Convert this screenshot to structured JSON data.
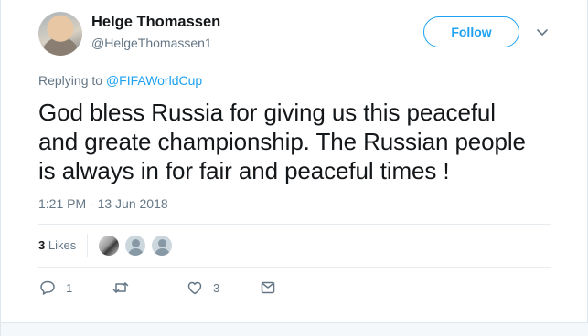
{
  "author": {
    "name": "Helge Thomassen",
    "handle": "@HelgeThomassen1"
  },
  "follow_label": "Follow",
  "reply_context": {
    "prefix": "Replying to",
    "mention": "@FIFAWorldCup"
  },
  "tweet": {
    "line1": "God bless Russia for giving us this peaceful",
    "line2": "and greate championship. The Russian people",
    "line3": "is always in for fair and peaceful times !"
  },
  "timestamp": "1:21 PM - 13 Jun 2018",
  "likes": {
    "count": "3",
    "label": "Likes"
  },
  "actions": {
    "reply_count": "1",
    "retweet_count": "",
    "like_count": "3"
  },
  "colors": {
    "accent": "#1da1f2",
    "text": "#14171a",
    "secondary": "#657786",
    "divider": "#e6ecf0"
  },
  "icons": [
    "chevron-down-icon",
    "reply-icon",
    "retweet-icon",
    "like-icon",
    "direct-message-icon"
  ]
}
